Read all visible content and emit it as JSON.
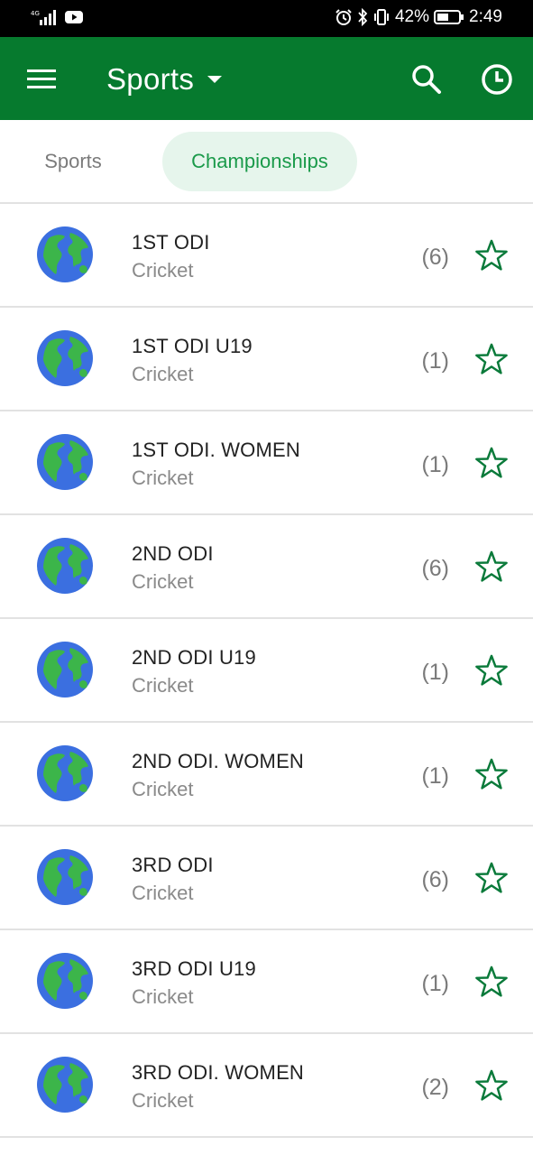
{
  "status_bar": {
    "battery": "42%",
    "time": "2:49"
  },
  "app_bar": {
    "title": "Sports"
  },
  "tabs": [
    {
      "label": "Sports",
      "active": false
    },
    {
      "label": "Championships",
      "active": true
    }
  ],
  "championships": [
    {
      "name": "1ST ODI",
      "sport": "Cricket",
      "count": "(6)"
    },
    {
      "name": "1ST ODI U19",
      "sport": "Cricket",
      "count": "(1)"
    },
    {
      "name": "1ST ODI. WOMEN",
      "sport": "Cricket",
      "count": "(1)"
    },
    {
      "name": "2ND ODI",
      "sport": "Cricket",
      "count": "(6)"
    },
    {
      "name": "2ND ODI U19",
      "sport": "Cricket",
      "count": "(1)"
    },
    {
      "name": "2ND ODI. WOMEN",
      "sport": "Cricket",
      "count": "(1)"
    },
    {
      "name": "3RD ODI",
      "sport": "Cricket",
      "count": "(6)"
    },
    {
      "name": "3RD ODI U19",
      "sport": "Cricket",
      "count": "(1)"
    },
    {
      "name": "3RD ODI. WOMEN",
      "sport": "Cricket",
      "count": "(2)"
    }
  ],
  "colors": {
    "primary": "#067a2e",
    "tab_active_text": "#1a9a4a",
    "tab_active_bg": "#e6f5ec",
    "star": "#0a7a3a",
    "globe_ocean": "#3b6fe0",
    "globe_land": "#3cb54a"
  },
  "icons": {
    "menu": "hamburger-menu-icon",
    "dropdown": "caret-down-icon",
    "search": "search-icon",
    "history": "clock-icon",
    "row_icon": "globe-icon",
    "favorite": "star-outline-icon"
  }
}
